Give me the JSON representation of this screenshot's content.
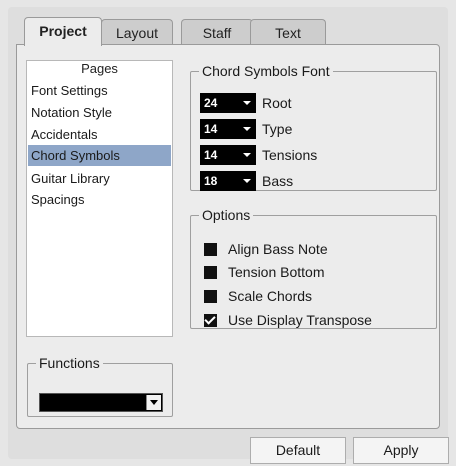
{
  "tabs": [
    {
      "label": "Project",
      "active": true
    },
    {
      "label": "Layout",
      "active": false
    },
    {
      "label": "Staff",
      "active": false
    },
    {
      "label": "Text",
      "active": false
    }
  ],
  "pages": {
    "title": "Pages",
    "items": [
      "Font Settings",
      "Notation Style",
      "Accidentals",
      "Chord Symbols",
      "Guitar Library",
      "Spacings"
    ],
    "selected": "Chord Symbols"
  },
  "chord_font": {
    "title": "Chord Symbols Font",
    "rows": [
      {
        "value": "24",
        "label": "Root"
      },
      {
        "value": "14",
        "label": "Type"
      },
      {
        "value": "14",
        "label": "Tensions"
      },
      {
        "value": "18",
        "label": "Bass"
      }
    ]
  },
  "options": {
    "title": "Options",
    "items": [
      {
        "label": "Align Bass Note",
        "checked": false
      },
      {
        "label": "Tension Bottom",
        "checked": false
      },
      {
        "label": "Scale Chords",
        "checked": false
      },
      {
        "label": "Use Display Transpose",
        "checked": true
      }
    ]
  },
  "functions": {
    "title": "Functions",
    "value": ""
  },
  "buttons": {
    "default_label": "Default",
    "apply_label": "Apply"
  },
  "colors": {
    "selection": "#8ea6c8",
    "control_bg": "#000000"
  },
  "icons": {
    "dropdown": "chevron-down-icon",
    "checkmark": "checkmark-icon"
  }
}
